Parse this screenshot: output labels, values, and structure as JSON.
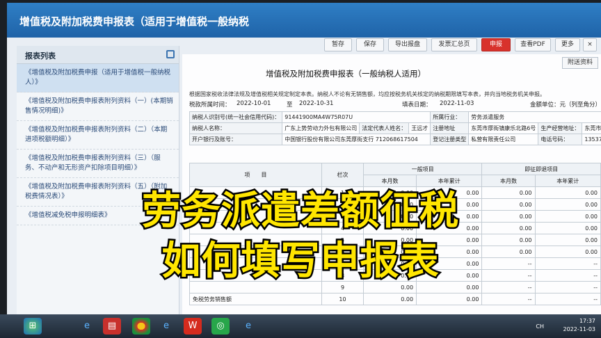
{
  "window": {
    "title": "增值税及附加税费申报表（适用于增值税一般纳税"
  },
  "toolbar": {
    "buttons": [
      "暂存",
      "保存",
      "导出报盘",
      "发票汇总页",
      "申报",
      "查看PDF",
      "更多"
    ]
  },
  "sidebar": {
    "heading": "报表列表",
    "items": [
      "《增值税及附加税费申报（适用于增值税一般纳税人）》",
      "《增值税及附加税费申报表附列资料（一）(本期销售情况明细)》",
      "《增值税及附加税费申报表附列资料（二）（本期进项税额明细）》",
      "《增值税及附加税费申报表附列资料（三）（服务、不动产和无形资产扣除项目明细）》",
      "《增值税及附加税费申报表附列资料（五）（附加税费情况表）》",
      "《增值税减免税申报明细表》"
    ]
  },
  "main": {
    "attach_button": "附送资料",
    "form_title": "增值税及附加税费申报表（一般纳税人适用）",
    "note": "根据国家税收法律法规及增值税相关规定制定本表。纳税人不论有无销售额，均应按税务机关核定的纳税期限填写本表，并向当地税务机关申报。",
    "period_label": "税款所属时间：",
    "period_from": "2022-10-01",
    "period_to_label": "至",
    "period_to": "2022-10-31",
    "fill_date_label": "填表日期：",
    "fill_date": "2022-11-03",
    "unit_label": "金额单位：元（列至角分）",
    "info": {
      "taxpayer_id_label": "纳税人识别号(统一社会信用代码)：",
      "taxpayer_id": "91441900MA4W75R07U",
      "industry_label": "所属行业：",
      "industry": "劳务派遣服务",
      "name_label": "纳税人名称：",
      "name": "广东上势劳动力外包有限公司",
      "legal_rep_label": "法定代表人姓名：",
      "legal_rep": "王远才",
      "reg_addr_label": "注册地址",
      "reg_addr": "东莞市厚街镇康乐北路6号",
      "biz_addr_label": "生产经营地址：",
      "biz_addr": "东莞市厚街镇康乐北路6号",
      "bank_label": "开户银行及账号：",
      "bank": "中国银行股份有限公司东莞厚街支行 712068617504",
      "reg_type_label": "登记注册类型",
      "reg_type": "私营有限责任公司",
      "phone_label": "电话号码：",
      "phone": "13537103885"
    },
    "grid": {
      "col_item": "项　　目",
      "col_row": "栏次",
      "col_general": "一般项目",
      "col_immediate": "即征即退项目",
      "col_month": "本月数",
      "col_year": "本年累计",
      "rows": [
        {
          "no": "1",
          "a": "",
          "b": "0.00",
          "c": "0.00",
          "d": "0.00"
        },
        {
          "no": "2",
          "a": "",
          "b": "0.00",
          "c": "0.00",
          "d": "0.00"
        },
        {
          "no": "3",
          "a": "",
          "b": "0.00",
          "c": "0.00",
          "d": "0.00"
        },
        {
          "no": "4",
          "a": "",
          "b": "0.00",
          "c": "0.00",
          "d": "0.00"
        },
        {
          "no": "5",
          "a": "",
          "b": "0.00",
          "c": "0.00",
          "d": "0.00"
        },
        {
          "no": "6",
          "a": "",
          "b": "0.00",
          "c": "0.00",
          "d": "0.00"
        },
        {
          "no": "7",
          "a": "",
          "b": "0.00",
          "c": "--",
          "d": "--"
        },
        {
          "no": "8",
          "a": "",
          "b": "0.00",
          "c": "--",
          "d": "--"
        },
        {
          "no": "9",
          "a": "",
          "b": "0.00",
          "c": "--",
          "d": "--"
        },
        {
          "no": "10",
          "a": "免税劳务销售额",
          "b": "0.00",
          "c": "--",
          "d": "--"
        }
      ]
    }
  },
  "caption": {
    "line1": "劳务派遣差额征税",
    "line2": "如何填写申报表"
  },
  "taskbar": {
    "time": "17:37",
    "date": "2022-11-03",
    "lang": "CH"
  }
}
